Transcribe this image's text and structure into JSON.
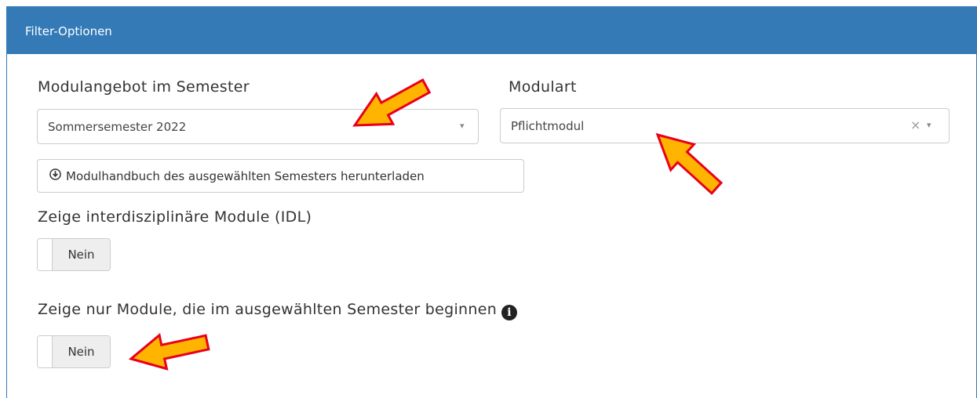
{
  "panel": {
    "title": "Filter-Optionen",
    "header_color": "#337ab7"
  },
  "semester": {
    "label": "Modulangebot im Semester",
    "selected": "Sommersemester 2022",
    "arrow": "▾"
  },
  "modulart": {
    "label": "Modulart",
    "selected": "Pflichtmodul",
    "clear": "×",
    "arrow": "▾"
  },
  "download": {
    "icon": "download-circle-icon",
    "label": "Modulhandbuch des ausgewählten Semesters herunterladen"
  },
  "idl": {
    "label": "Zeige interdisziplinäre Module (IDL)",
    "toggle_value": "Nein"
  },
  "begin": {
    "label": "Zeige nur Module, die im ausgewählten Semester beginnen",
    "info_icon": "i",
    "toggle_value": "Nein"
  },
  "annotation_arrows": {
    "fill": "#ffb400",
    "stroke": "#e8001c"
  }
}
